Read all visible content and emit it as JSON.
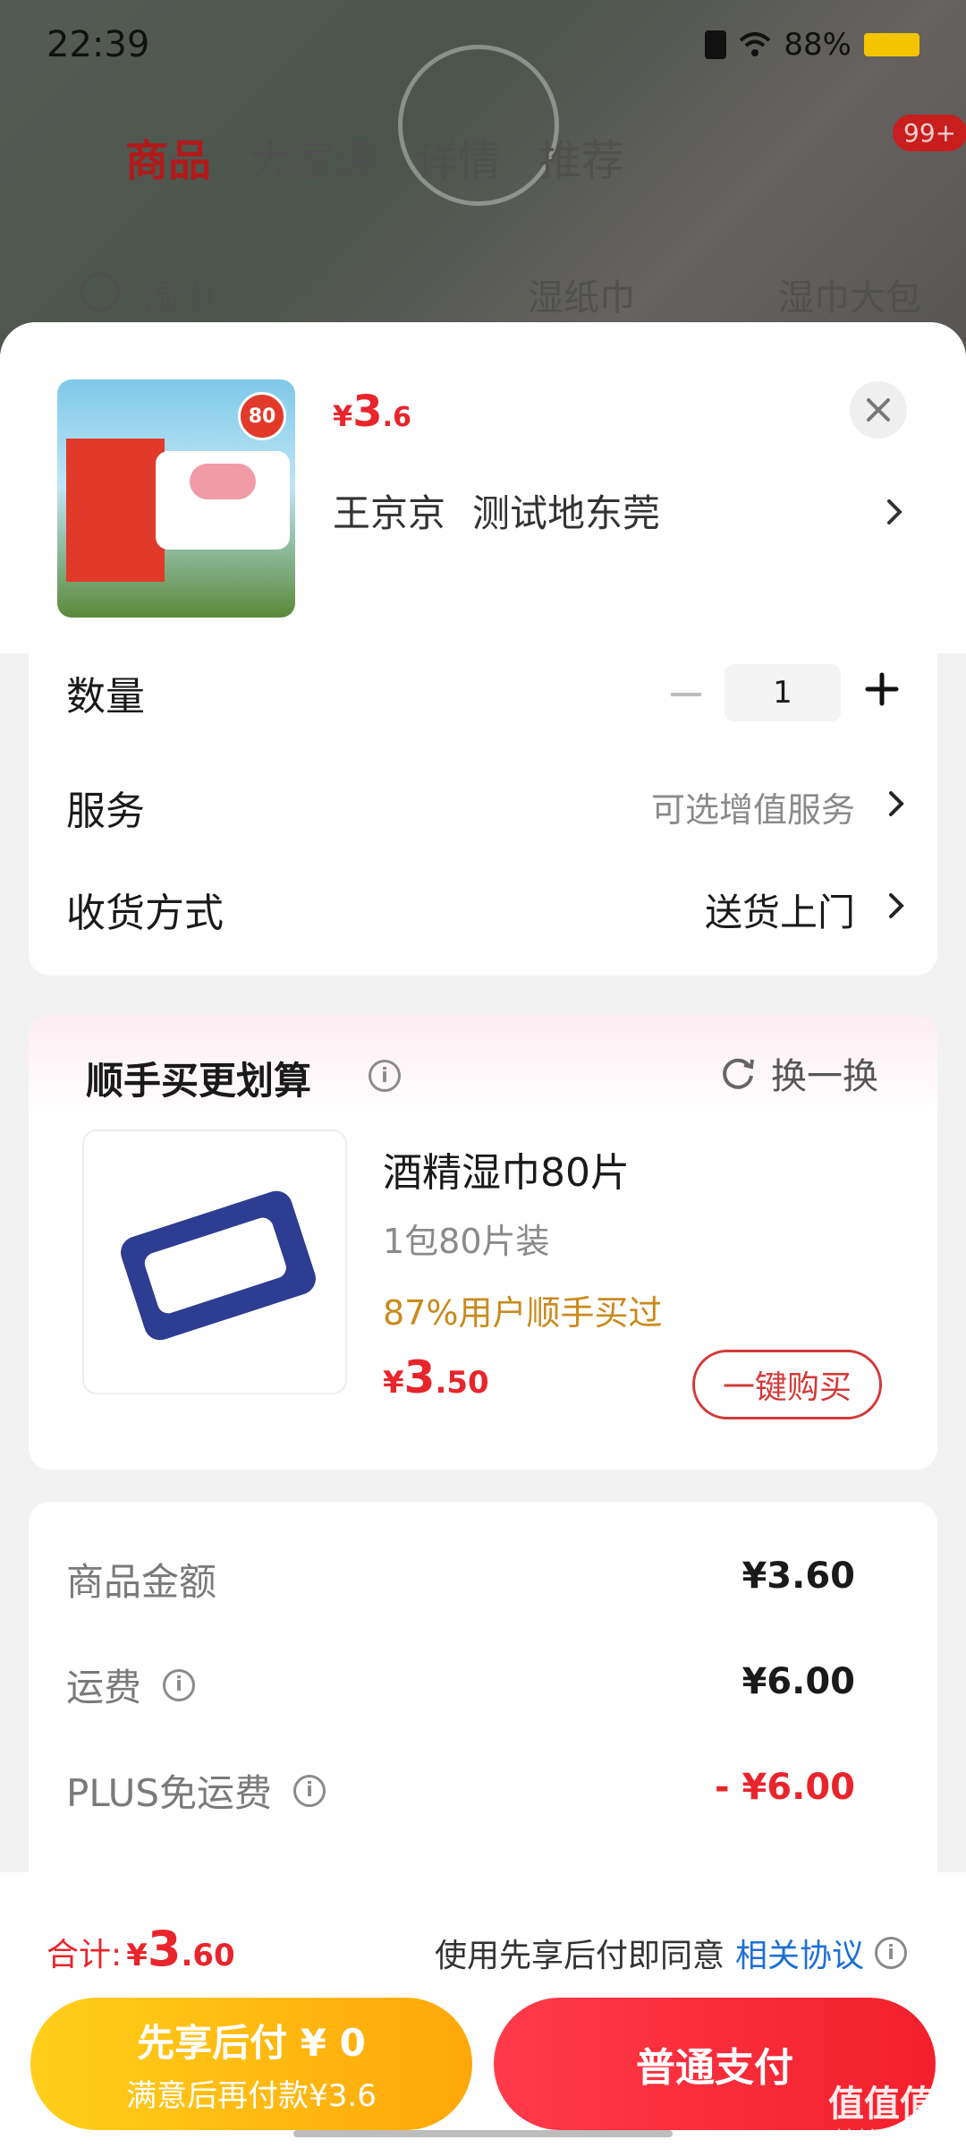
{
  "status_bar": {
    "time": "22:39",
    "battery": "88%"
  },
  "background_page": {
    "tabs": [
      "商品",
      "大家评",
      "详情",
      "推荐"
    ],
    "badge": "99+",
    "search_terms": [
      "湿巾",
      "湿纸巾",
      "湿巾大包"
    ]
  },
  "product": {
    "price_symbol": "¥",
    "price_int": "3",
    "price_dec": ".6",
    "address_name": "王京京",
    "address_place": "测试地东莞",
    "thumb_seal": "80"
  },
  "options": {
    "quantity_label": "数量",
    "quantity_value": "1",
    "service_label": "服务",
    "service_value": "可选增值服务",
    "delivery_label": "收货方式",
    "delivery_value": "送货上门"
  },
  "recommend": {
    "title": "顺手买更划算",
    "refresh_label": "换一换",
    "item_name": "酒精湿巾80片",
    "item_spec": "1包80片装",
    "item_social": "87%用户顺手买过",
    "price_symbol": "¥",
    "price_int": "3",
    "price_dec": ".50",
    "buy_label": "一键购买"
  },
  "summary": {
    "goods_amount_label": "商品金额",
    "goods_amount_value": "¥3.60",
    "shipping_label": "运费",
    "shipping_value": "¥6.00",
    "plus_label": "PLUS免运费",
    "plus_value": "- ¥6.00"
  },
  "footer": {
    "total_label": "合计:",
    "total_symbol": "¥",
    "total_int": "3",
    "total_dec": ".60",
    "agree_text": "使用先享后付即同意",
    "agree_link": "相关协议",
    "bnpl_line1": "先享后付 ¥ 0",
    "bnpl_line2": "满意后再付款¥3.6",
    "pay_label": "普通支付"
  },
  "watermark": {
    "main": "值值值",
    "sub": "zhizhizhi.com"
  },
  "colors": {
    "accent_red": "#e8252c",
    "link_blue": "#1f6fd6",
    "social_orange": "#c98a1e",
    "bnpl_yellow": "#ffb20f"
  }
}
